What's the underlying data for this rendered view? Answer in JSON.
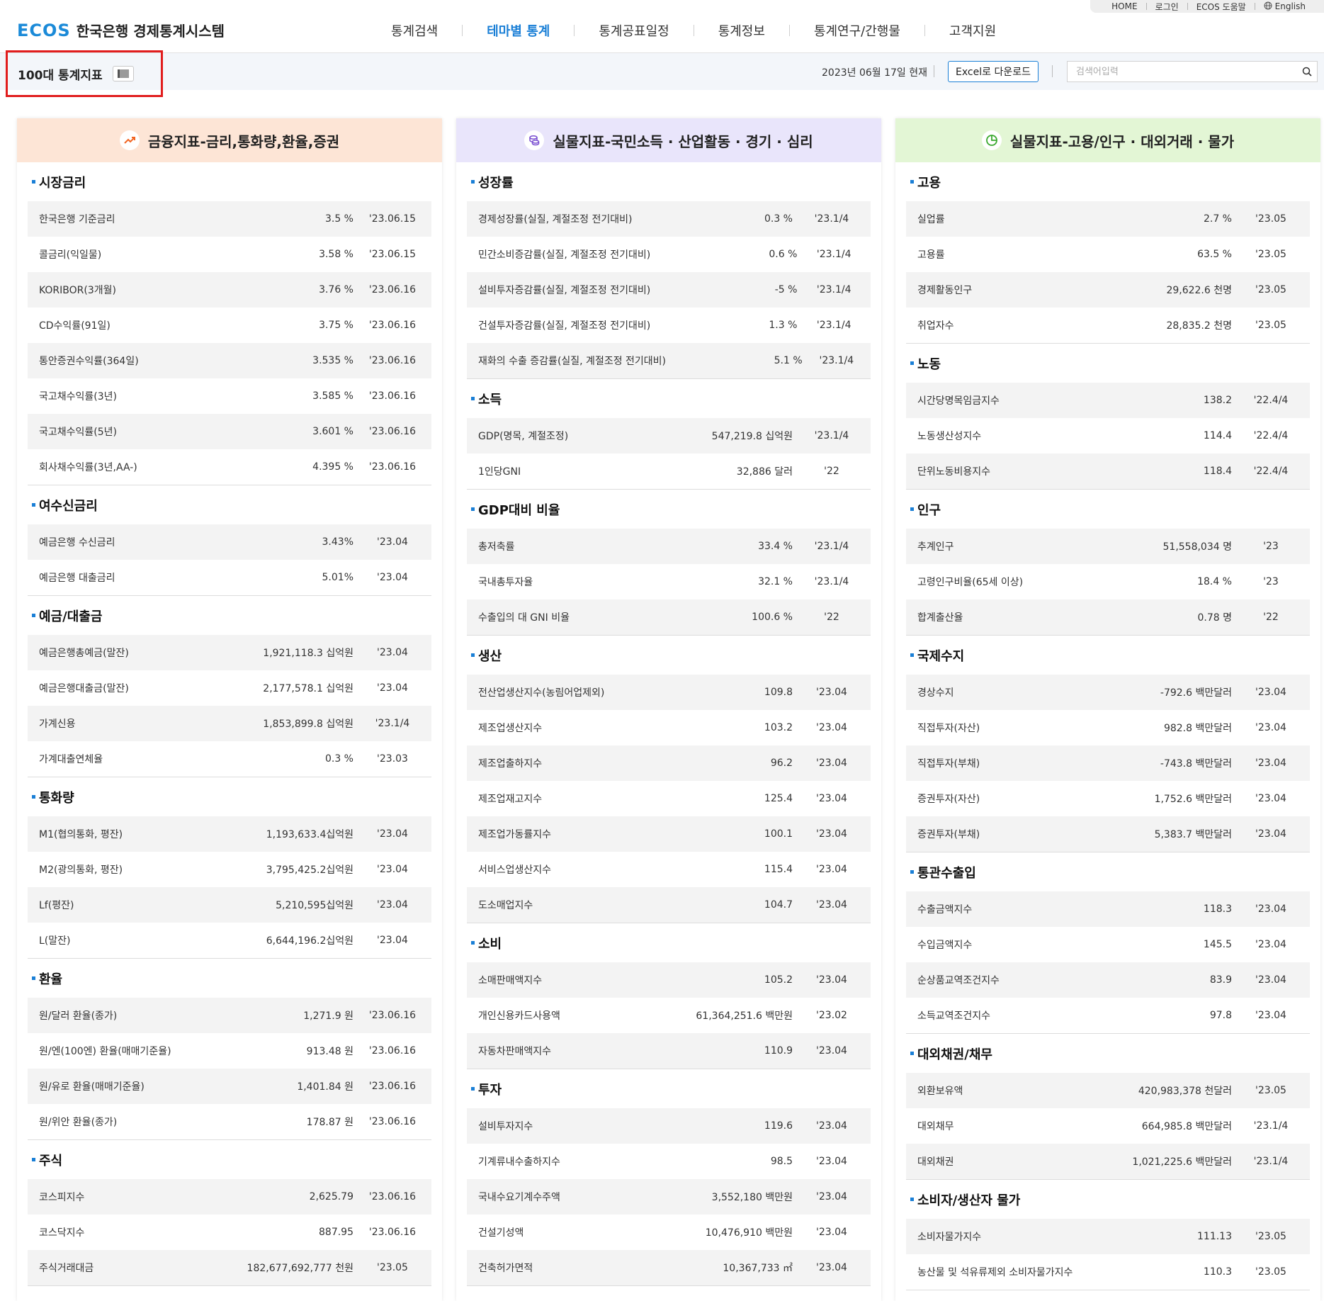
{
  "util_links": [
    "HOME",
    "로그인",
    "ECOS 도움말",
    "English"
  ],
  "logo": {
    "mark": "ECOS",
    "title": "한국은행 경제통계시스템"
  },
  "gnb": [
    {
      "label": "통계검색",
      "active": false
    },
    {
      "label": "테마별 통계",
      "active": true
    },
    {
      "label": "통계공표일정",
      "active": false
    },
    {
      "label": "통계정보",
      "active": false
    },
    {
      "label": "통계연구/간행물",
      "active": false
    },
    {
      "label": "고객지원",
      "active": false
    }
  ],
  "page_title": "100대 통계지표",
  "as_of": "2023년 06월 17일 현재",
  "excel_label": "Excel로 다운로드",
  "search_placeholder": "검색어입력",
  "colors": {
    "accent": "#1a7fd6",
    "col1_head": "#fde5d6",
    "col2_head": "#e9e5fb",
    "col3_head": "#e3f6d5",
    "highlight": "#e11d1d"
  },
  "columns": [
    {
      "title": "금융지표-금리,통화량,환율,증권",
      "icon": "trend-up-icon",
      "sections": [
        {
          "title": "시장금리",
          "rows": [
            [
              "한국은행 기준금리",
              "3.5 %",
              "'23.06.15"
            ],
            [
              "콜금리(익일물)",
              "3.58 %",
              "'23.06.15"
            ],
            [
              "KORIBOR(3개월)",
              "3.76 %",
              "'23.06.16"
            ],
            [
              "CD수익률(91일)",
              "3.75 %",
              "'23.06.16"
            ],
            [
              "통안증권수익률(364일)",
              "3.535 %",
              "'23.06.16"
            ],
            [
              "국고채수익률(3년)",
              "3.585 %",
              "'23.06.16"
            ],
            [
              "국고채수익률(5년)",
              "3.601 %",
              "'23.06.16"
            ],
            [
              "회사채수익률(3년,AA-)",
              "4.395 %",
              "'23.06.16"
            ]
          ]
        },
        {
          "title": "여수신금리",
          "rows": [
            [
              "예금은행 수신금리",
              "3.43%",
              "'23.04"
            ],
            [
              "예금은행 대출금리",
              "5.01%",
              "'23.04"
            ]
          ]
        },
        {
          "title": "예금/대출금",
          "rows": [
            [
              "예금은행총예금(말잔)",
              "1,921,118.3 십억원",
              "'23.04"
            ],
            [
              "예금은행대출금(말잔)",
              "2,177,578.1 십억원",
              "'23.04"
            ],
            [
              "가계신용",
              "1,853,899.8 십억원",
              "'23.1/4"
            ],
            [
              "가계대출연체율",
              "0.3 %",
              "'23.03"
            ]
          ]
        },
        {
          "title": "통화량",
          "rows": [
            [
              "M1(협의통화, 평잔)",
              "1,193,633.4십억원",
              "'23.04"
            ],
            [
              "M2(광의통화, 평잔)",
              "3,795,425.2십억원",
              "'23.04"
            ],
            [
              "Lf(평잔)",
              "5,210,595십억원",
              "'23.04"
            ],
            [
              "L(말잔)",
              "6,644,196.2십억원",
              "'23.04"
            ]
          ]
        },
        {
          "title": "환율",
          "rows": [
            [
              "원/달러 환율(종가)",
              "1,271.9 원",
              "'23.06.16"
            ],
            [
              "원/엔(100엔) 환율(매매기준율)",
              "913.48 원",
              "'23.06.16"
            ],
            [
              "원/유로 환율(매매기준율)",
              "1,401.84 원",
              "'23.06.16"
            ],
            [
              "원/위안 환율(종가)",
              "178.87 원",
              "'23.06.16"
            ]
          ]
        },
        {
          "title": "주식",
          "rows": [
            [
              "코스피지수",
              "2,625.79",
              "'23.06.16"
            ],
            [
              "코스닥지수",
              "887.95",
              "'23.06.16"
            ],
            [
              "주식거래대금",
              "182,677,692,777 천원",
              "'23.05"
            ]
          ]
        }
      ]
    },
    {
      "title": "실물지표-국민소득 · 산업활동 · 경기 · 심리",
      "icon": "coins-icon",
      "sections": [
        {
          "title": "성장률",
          "rows": [
            [
              "경제성장률(실질, 계절조정 전기대비)",
              "0.3 %",
              "'23.1/4"
            ],
            [
              "민간소비증감률(실질, 계절조정 전기대비)",
              "0.6 %",
              "'23.1/4"
            ],
            [
              "설비투자증감률(실질, 계절조정 전기대비)",
              "-5 %",
              "'23.1/4"
            ],
            [
              "건설투자증감률(실질, 계절조정 전기대비)",
              "1.3 %",
              "'23.1/4"
            ],
            [
              "재화의 수출 증감률(실질, 계절조정 전기대비)",
              "5.1 %",
              "'23.1/4"
            ]
          ]
        },
        {
          "title": "소득",
          "rows": [
            [
              "GDP(명목, 계절조정)",
              "547,219.8 십억원",
              "'23.1/4"
            ],
            [
              "1인당GNI",
              "32,886 달러",
              "'22"
            ]
          ]
        },
        {
          "title": "GDP대비 비율",
          "rows": [
            [
              "총저축률",
              "33.4 %",
              "'23.1/4"
            ],
            [
              "국내총투자율",
              "32.1 %",
              "'23.1/4"
            ],
            [
              "수출입의 대 GNI 비율",
              "100.6 %",
              "'22"
            ]
          ]
        },
        {
          "title": "생산",
          "rows": [
            [
              "전산업생산지수(농림어업제외)",
              "109.8",
              "'23.04"
            ],
            [
              "제조업생산지수",
              "103.2",
              "'23.04"
            ],
            [
              "제조업출하지수",
              "96.2",
              "'23.04"
            ],
            [
              "제조업재고지수",
              "125.4",
              "'23.04"
            ],
            [
              "제조업가동률지수",
              "100.1",
              "'23.04"
            ],
            [
              "서비스업생산지수",
              "115.4",
              "'23.04"
            ],
            [
              "도소매업지수",
              "104.7",
              "'23.04"
            ]
          ]
        },
        {
          "title": "소비",
          "rows": [
            [
              "소매판매액지수",
              "105.2",
              "'23.04"
            ],
            [
              "개인신용카드사용액",
              "61,364,251.6 백만원",
              "'23.02"
            ],
            [
              "자동차판매액지수",
              "110.9",
              "'23.04"
            ]
          ]
        },
        {
          "title": "투자",
          "rows": [
            [
              "설비투자지수",
              "119.6",
              "'23.04"
            ],
            [
              "기계류내수출하지수",
              "98.5",
              "'23.04"
            ],
            [
              "국내수요기계수주액",
              "3,552,180 백만원",
              "'23.04"
            ],
            [
              "건설기성액",
              "10,476,910 백만원",
              "'23.04"
            ],
            [
              "건축허가면적",
              "10,367,733 ㎡",
              "'23.04"
            ]
          ]
        }
      ]
    },
    {
      "title": "실물지표-고용/인구 · 대외거래 · 물가",
      "icon": "pie-chart-icon",
      "sections": [
        {
          "title": "고용",
          "rows": [
            [
              "실업률",
              "2.7 %",
              "'23.05"
            ],
            [
              "고용률",
              "63.5 %",
              "'23.05"
            ],
            [
              "경제활동인구",
              "29,622.6 천명",
              "'23.05"
            ],
            [
              "취업자수",
              "28,835.2 천명",
              "'23.05"
            ]
          ]
        },
        {
          "title": "노동",
          "rows": [
            [
              "시간당명목임금지수",
              "138.2",
              "'22.4/4"
            ],
            [
              "노동생산성지수",
              "114.4",
              "'22.4/4"
            ],
            [
              "단위노동비용지수",
              "118.4",
              "'22.4/4"
            ]
          ]
        },
        {
          "title": "인구",
          "rows": [
            [
              "추계인구",
              "51,558,034 명",
              "'23"
            ],
            [
              "고령인구비율(65세 이상)",
              "18.4 %",
              "'23"
            ],
            [
              "합계출산율",
              "0.78 명",
              "'22"
            ]
          ]
        },
        {
          "title": "국제수지",
          "rows": [
            [
              "경상수지",
              "-792.6 백만달러",
              "'23.04"
            ],
            [
              "직접투자(자산)",
              "982.8 백만달러",
              "'23.04"
            ],
            [
              "직접투자(부채)",
              "-743.8 백만달러",
              "'23.04"
            ],
            [
              "증권투자(자산)",
              "1,752.6 백만달러",
              "'23.04"
            ],
            [
              "증권투자(부채)",
              "5,383.7 백만달러",
              "'23.04"
            ]
          ]
        },
        {
          "title": "통관수출입",
          "rows": [
            [
              "수출금액지수",
              "118.3",
              "'23.04"
            ],
            [
              "수입금액지수",
              "145.5",
              "'23.04"
            ],
            [
              "순상품교역조건지수",
              "83.9",
              "'23.04"
            ],
            [
              "소득교역조건지수",
              "97.8",
              "'23.04"
            ]
          ]
        },
        {
          "title": "대외채권/채무",
          "rows": [
            [
              "외환보유액",
              "420,983,378 천달러",
              "'23.05"
            ],
            [
              "대외채무",
              "664,985.8 백만달러",
              "'23.1/4"
            ],
            [
              "대외채권",
              "1,021,225.6 백만달러",
              "'23.1/4"
            ]
          ]
        },
        {
          "title": "소비자/생산자 물가",
          "rows": [
            [
              "소비자물가지수",
              "111.13",
              "'23.05"
            ],
            [
              "농산물 및 석유류제외 소비자물가지수",
              "110.3",
              "'23.05"
            ]
          ]
        }
      ]
    }
  ]
}
